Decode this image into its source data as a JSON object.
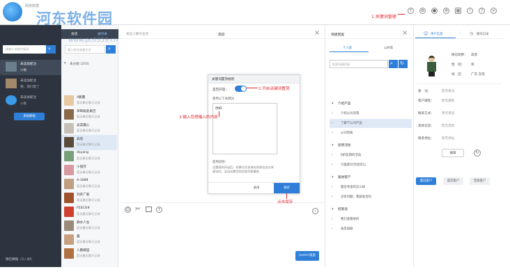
{
  "watermark": {
    "brand": "河东软件园",
    "url": "www.pc0359.cn",
    "logo_text": "网络数据"
  },
  "toolbar": {
    "annotation": "1.关键词管理",
    "icons": [
      "clock-upload-icon",
      "gear-icon",
      "eye-icon",
      "sparkle-icon",
      "grid-icon",
      "info-icon",
      "help-icon",
      "close-icon"
    ]
  },
  "left_panel": {
    "search_placeholder": "请输入关键字搜索",
    "items": [
      {
        "title": "未读加星注",
        "sub": "小助"
      },
      {
        "title": "未读加星注",
        "sub": "哦，那打醒了"
      },
      {
        "title": "未读加星注",
        "sub": "小助"
      }
    ],
    "add_button": "添加新组",
    "footer": "微信数据（3 / 40）"
  },
  "contacts_panel": {
    "tab_chat": "会话",
    "tab_contacts": "通讯录",
    "search_placeholder": "输入姓名或备注名",
    "group_label": "未分组 (203)",
    "contacts": [
      {
        "name": "A鹏鑫",
        "status": "暂无最近聊天记录",
        "color": "#e8c8a0"
      },
      {
        "name": "单晖毅此尾巴",
        "status": "暂无最近聊天记录",
        "color": "#8a6a4a"
      },
      {
        "name": "吴昊露心",
        "status": "暂无最近聊天记录",
        "color": "#c7c0b8"
      },
      {
        "name": "高欣",
        "status": "暂无最近聊天记录",
        "color": "#5a4a3a"
      },
      {
        "name": "dayang",
        "status": "暂无最近聊天记录",
        "color": "#7aa07a"
      },
      {
        "name": "小丽莎",
        "status": "暂无最近聊天记录",
        "color": "#d89aa0"
      },
      {
        "name": "A-1688",
        "status": "暂无最近聊天记录",
        "color": "#c0a080"
      },
      {
        "name": "刘开广家",
        "status": "暂无最近聊天记录",
        "color": "#a0522d"
      },
      {
        "name": "FESCO#",
        "status": "暂无最近聊天记录",
        "color": "#d04030"
      },
      {
        "name": "静水人生",
        "status": "暂无最近聊天记录",
        "color": "#9a8a7a"
      },
      {
        "name": "露",
        "status": "暂无最近聊天记录",
        "color": "#c8a080"
      },
      {
        "name": "人鹏解囧",
        "status": "暂无最近聊天记录",
        "color": "#b07040"
      }
    ]
  },
  "chat_panel": {
    "tab_label": "来自小鹏的会话",
    "title": "高欣",
    "send_button": "[enter]发送"
  },
  "dialog": {
    "title": "关键词置顶规则",
    "enable_label": "是否开启：",
    "keyword_label": "使用以下关键词",
    "keyword_value": "你好",
    "note_title": "使用说明：",
    "note_text": "设置规则开启后，如果对方发来的消息包含在关键词内，会自动置顶到消息列表最前",
    "cancel": "关闭",
    "save": "保存",
    "annotation_toggle": "2.开启关键词置顶",
    "annotation_input": "3.输入您想输入的内容",
    "annotation_save": "点击保存"
  },
  "quick_reply": {
    "title": "快捷回复",
    "tab_personal": "个人库",
    "tab_public": "公共库",
    "search_placeholder": "搜索快捷回复",
    "groups": [
      {
        "label": "介绍产品",
        "expanded": true,
        "items": [
          "介绍公司背景",
          "了解下公司产品",
          "公司资质"
        ]
      },
      {
        "label": "促销活动",
        "expanded": true,
        "items": [
          "6折促销的活动",
          "只能第50元就可以"
        ]
      },
      {
        "label": "跟进客户",
        "expanded": true,
        "items": [
          "最近考虑的怎么样",
          "没有问题，我就发合同"
        ]
      },
      {
        "label": "结束语",
        "expanded": true,
        "items": [
          "我们会跟进的",
          "再见再联"
        ]
      }
    ]
  },
  "profile_panel": {
    "tab_info": "用户信息",
    "tab_history": "聊天记录",
    "nickname_label": "微信昵称：",
    "nickname": "高欣",
    "gender_label": "性　别：",
    "gender": "男",
    "region_label": "地　区：",
    "region": "广东 东莞",
    "fields": [
      {
        "label": "备　注：",
        "value": "暂无备注"
      },
      {
        "label": "客户属性：",
        "value": "暂无属性"
      },
      {
        "label": "联系方式：",
        "value": "暂无电话"
      },
      {
        "label": "其他信息：",
        "value": "暂无其他"
      },
      {
        "label": "联系地址：",
        "value": "暂无地址"
      }
    ],
    "edit_button": "编辑",
    "status_buttons": [
      "意向客户",
      "成交客户",
      "无效客户"
    ],
    "accent": "#2f7fd8"
  }
}
